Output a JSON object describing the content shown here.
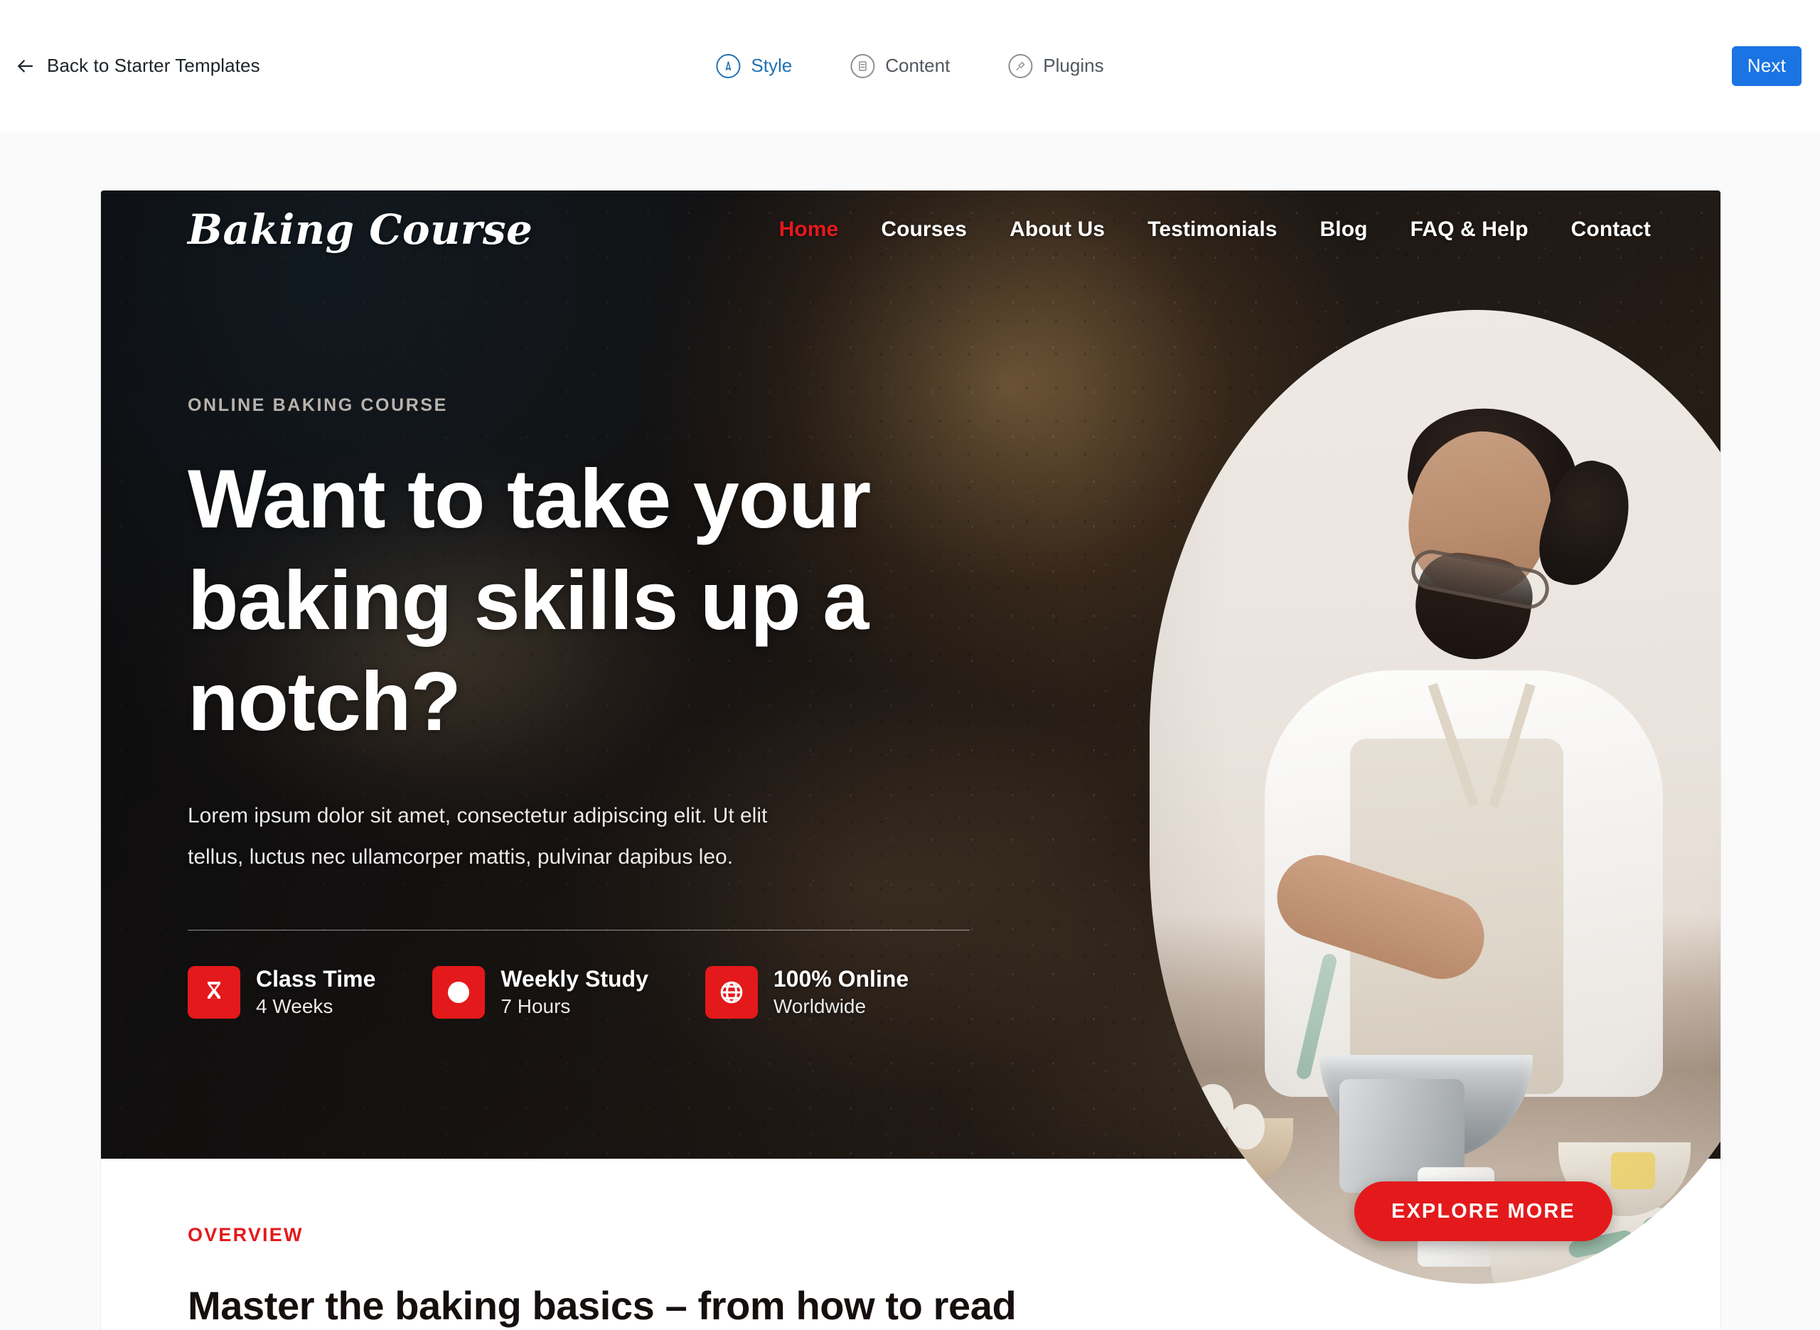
{
  "app_bar": {
    "back_label": "Back to Starter Templates",
    "back_icon": "arrow-left-icon",
    "steps": [
      {
        "label": "Style",
        "icon": "compass-icon",
        "active": true
      },
      {
        "label": "Content",
        "icon": "document-icon",
        "active": false
      },
      {
        "label": "Plugins",
        "icon": "plug-icon",
        "active": false
      }
    ],
    "next_label": "Next",
    "next_color": "#1b74e4"
  },
  "preview": {
    "site": {
      "logo": "Baking Course",
      "nav": [
        {
          "label": "Home",
          "active": true
        },
        {
          "label": "Courses",
          "active": false
        },
        {
          "label": "About Us",
          "active": false
        },
        {
          "label": "Testimonials",
          "active": false
        },
        {
          "label": "Blog",
          "active": false
        },
        {
          "label": "FAQ & Help",
          "active": false
        },
        {
          "label": "Contact",
          "active": false
        }
      ],
      "hero": {
        "eyebrow": "ONLINE BAKING COURSE",
        "title": "Want to take your baking skills up a notch?",
        "subtitle": "Lorem ipsum dolor sit amet, consectetur adipiscing elit. Ut elit tellus, luctus nec ullamcorper mattis, pulvinar dapibus leo.",
        "cta_label": "EXPLORE MORE",
        "features": [
          {
            "title": "Class Time",
            "value": "4 Weeks",
            "icon": "hourglass-icon"
          },
          {
            "title": "Weekly Study",
            "value": "7 Hours",
            "icon": "clock-icon"
          },
          {
            "title": "100% Online",
            "value": "Worldwide",
            "icon": "globe-icon"
          }
        ]
      },
      "overview": {
        "label": "OVERVIEW",
        "heading": "Master the baking basics – from how to read"
      },
      "colors": {
        "accent_red": "#e4191b",
        "hero_dark": "#1b1715"
      }
    }
  }
}
